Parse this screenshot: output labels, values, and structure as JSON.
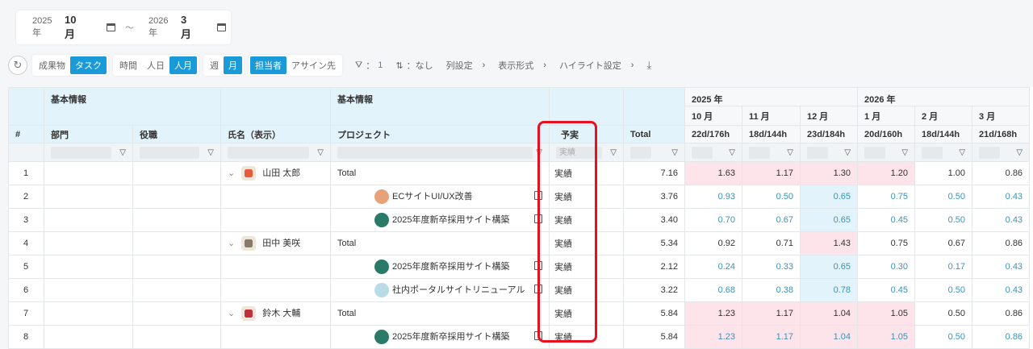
{
  "date_range": {
    "start_year": "2025年",
    "start_month": "10月",
    "separator": "～",
    "end_year": "2026年",
    "end_month": "3月"
  },
  "toolbar": {
    "view": [
      {
        "label": "成果物",
        "on": false
      },
      {
        "label": "タスク",
        "on": true
      }
    ],
    "unit": [
      {
        "label": "時間",
        "on": false
      },
      {
        "label": "人日",
        "on": false
      },
      {
        "label": "人月",
        "on": true
      }
    ],
    "period": [
      {
        "label": "週",
        "on": false
      },
      {
        "label": "月",
        "on": true
      }
    ],
    "assign": [
      {
        "label": "担当者",
        "on": true
      },
      {
        "label": "アサイン先",
        "on": false
      }
    ],
    "filter_label": "：",
    "filter_count": "1",
    "sort_label": "：なし",
    "column_settings": "列設定",
    "display_format": "表示形式",
    "highlight_settings": "ハイライト設定"
  },
  "header": {
    "group_basic1": "基本情報",
    "group_basic2": "基本情報",
    "year_2025": "2025 年",
    "year_2026": "2026 年",
    "months": [
      "10 月",
      "11 月",
      "12 月",
      "1 月",
      "2 月",
      "3 月"
    ],
    "capacity": [
      "22d/176h",
      "18d/144h",
      "23d/184h",
      "20d/160h",
      "18d/144h",
      "21d/168h"
    ],
    "cols": {
      "no": "#",
      "dept": "部門",
      "role": "役職",
      "name": "氏名（表示）",
      "project": "プロジェクト",
      "plan": "予実",
      "total": "Total"
    },
    "plan_filter_placeholder": "実績"
  },
  "rows": [
    {
      "no": "1",
      "type": "total",
      "name": "山田 太郎",
      "project": "Total",
      "plan": "実績",
      "total": "7.16",
      "values": [
        "1.63",
        "1.17",
        "1.30",
        "1.20",
        "1.00",
        "0.86"
      ]
    },
    {
      "no": "2",
      "type": "child",
      "project": "ECサイトUI/UX改善",
      "plan": "実績",
      "total": "3.76",
      "values": [
        "0.93",
        "0.50",
        "0.65",
        "0.75",
        "0.50",
        "0.43"
      ]
    },
    {
      "no": "3",
      "type": "child",
      "project": "2025年度新卒採用サイト構築",
      "plan": "実績",
      "total": "3.40",
      "values": [
        "0.70",
        "0.67",
        "0.65",
        "0.45",
        "0.50",
        "0.43"
      ]
    },
    {
      "no": "4",
      "type": "total",
      "name": "田中 美咲",
      "project": "Total",
      "plan": "実績",
      "total": "5.34",
      "values": [
        "0.92",
        "0.71",
        "1.43",
        "0.75",
        "0.67",
        "0.86"
      ]
    },
    {
      "no": "5",
      "type": "child",
      "project": "2025年度新卒採用サイト構築",
      "plan": "実績",
      "total": "2.12",
      "values": [
        "0.24",
        "0.33",
        "0.65",
        "0.30",
        "0.17",
        "0.43"
      ]
    },
    {
      "no": "6",
      "type": "child",
      "project": "社内ポータルサイトリニューアル",
      "plan": "実績",
      "total": "3.22",
      "values": [
        "0.68",
        "0.38",
        "0.78",
        "0.45",
        "0.50",
        "0.43"
      ]
    },
    {
      "no": "7",
      "type": "total",
      "name": "鈴木 大輔",
      "project": "Total",
      "plan": "実績",
      "total": "5.84",
      "values": [
        "1.23",
        "1.17",
        "1.04",
        "1.05",
        "0.50",
        "0.86"
      ]
    },
    {
      "no": "8",
      "type": "child",
      "project": "2025年度新卒採用サイト構築",
      "plan": "実績",
      "total": "5.84",
      "values": [
        "1.23",
        "1.17",
        "1.04",
        "1.05",
        "0.50",
        "0.86"
      ]
    }
  ],
  "colors": {
    "accent": "#1a9ad9",
    "highlight_over": "#fde3ea",
    "highlight_col": "#e3f3fb",
    "child_text": "#3b93b8",
    "annotation": "#e8101e"
  }
}
